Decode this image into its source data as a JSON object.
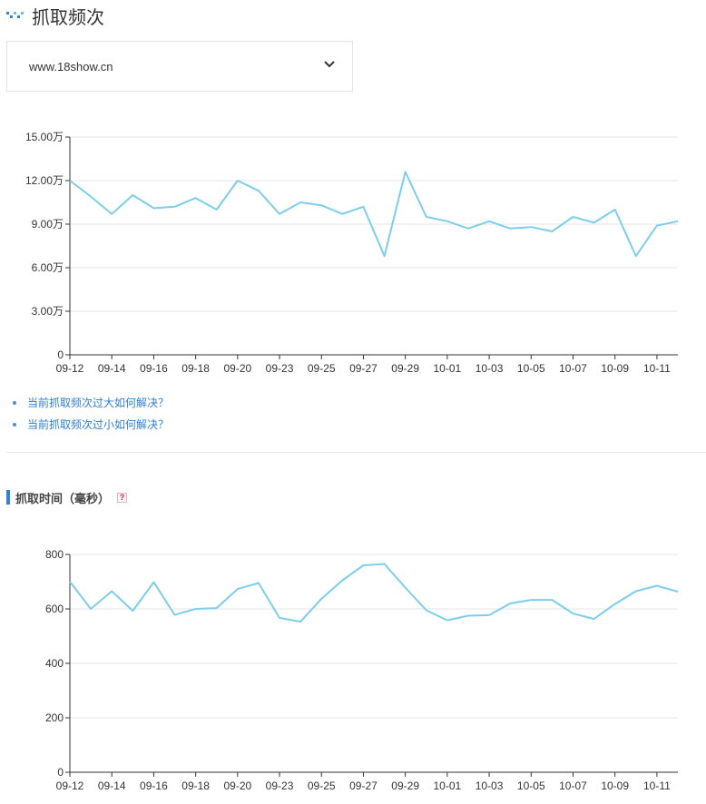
{
  "header": {
    "title": "抓取频次",
    "icon": "chart-logo-icon"
  },
  "site_select": {
    "value": "www.18show.cn"
  },
  "tips": [
    {
      "label": "当前抓取频次过大如何解决？"
    },
    {
      "label": "当前抓取频次过小如何解决？"
    }
  ],
  "section2": {
    "title": "抓取时间（毫秒）",
    "help": "?"
  },
  "colors": {
    "line": "#7dcdec",
    "grid": "#e6e6e6",
    "axis": "#333333",
    "accent": "#2f84d5",
    "link": "#2f7fd1"
  },
  "chart_data": [
    {
      "type": "line",
      "title": "",
      "xlabel": "",
      "ylabel": "",
      "x": [
        "09-12",
        "09-13",
        "09-14",
        "09-15",
        "09-16",
        "09-17",
        "09-18",
        "09-19",
        "09-20",
        "09-21",
        "09-23",
        "09-24",
        "09-25",
        "09-26",
        "09-27",
        "09-28",
        "09-29",
        "09-30",
        "10-01",
        "10-02",
        "10-03",
        "10-04",
        "10-05",
        "10-06",
        "10-07",
        "10-08",
        "10-09",
        "10-10",
        "10-11",
        "10-12"
      ],
      "tick_labels": [
        "09-12",
        "09-14",
        "09-16",
        "09-18",
        "09-20",
        "09-23",
        "09-25",
        "09-27",
        "09-29",
        "10-01",
        "10-03",
        "10-05",
        "10-07",
        "10-09",
        "10-11"
      ],
      "y_tick_labels": [
        "0",
        "3.00万",
        "6.00万",
        "9.00万",
        "12.00万",
        "15.00万"
      ],
      "ylim": [
        0,
        150000
      ],
      "y_ticks": [
        0,
        30000,
        60000,
        90000,
        120000,
        150000
      ],
      "grid": true,
      "series": [
        {
          "values": [
            120000,
            109000,
            97000,
            110000,
            101000,
            102000,
            108000,
            100000,
            120000,
            113000,
            97000,
            105000,
            103000,
            97000,
            102000,
            68000,
            126000,
            95000,
            92000,
            87000,
            92000,
            87000,
            88000,
            85000,
            95000,
            91000,
            100000,
            68000,
            89000,
            92000
          ]
        }
      ]
    },
    {
      "type": "line",
      "title": "",
      "xlabel": "",
      "ylabel": "",
      "x": [
        "09-12",
        "09-13",
        "09-14",
        "09-15",
        "09-16",
        "09-17",
        "09-18",
        "09-19",
        "09-20",
        "09-21",
        "09-23",
        "09-24",
        "09-25",
        "09-26",
        "09-27",
        "09-28",
        "09-29",
        "09-30",
        "10-01",
        "10-02",
        "10-03",
        "10-04",
        "10-05",
        "10-06",
        "10-07",
        "10-08",
        "10-09",
        "10-10",
        "10-11",
        "10-12"
      ],
      "tick_labels": [
        "09-12",
        "09-14",
        "09-16",
        "09-18",
        "09-20",
        "09-23",
        "09-25",
        "09-27",
        "09-29",
        "10-01",
        "10-03",
        "10-05",
        "10-07",
        "10-09",
        "10-11"
      ],
      "y_tick_labels": [
        "0",
        "200",
        "400",
        "600",
        "800"
      ],
      "ylim": [
        0,
        800
      ],
      "y_ticks": [
        0,
        200,
        400,
        600,
        800
      ],
      "grid": true,
      "series": [
        {
          "values": [
            700,
            600,
            665,
            593,
            698,
            578,
            600,
            603,
            673,
            695,
            567,
            553,
            637,
            705,
            760,
            765,
            678,
            595,
            558,
            575,
            577,
            620,
            633,
            633,
            583,
            563,
            618,
            665,
            685,
            663
          ]
        }
      ]
    }
  ]
}
